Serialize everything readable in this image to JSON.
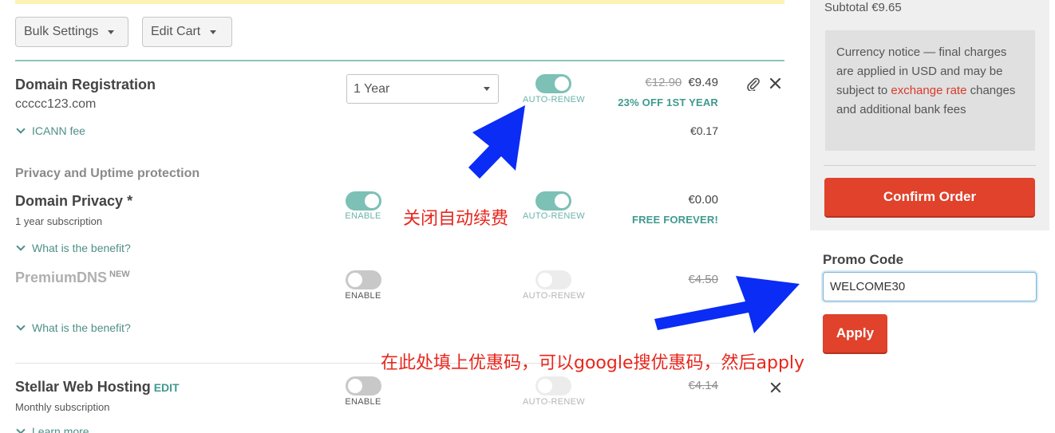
{
  "sidebar": {
    "subtotal": "Subtotal €9.65",
    "notice_before": "Currency notice — final charges are applied in USD and may be subject to ",
    "notice_link": "exchange rate",
    "notice_after": " changes and additional bank fees",
    "confirm_label": "Confirm Order",
    "promo_label": "Promo Code",
    "promo_value": "WELCOME30",
    "apply_label": "Apply"
  },
  "toolbar": {
    "bulk_settings": "Bulk Settings",
    "edit_cart": "Edit Cart"
  },
  "domain_registration": {
    "title": "Domain Registration",
    "domain": "ccccc123.com",
    "period": "1 Year",
    "toggle_label": "AUTO-RENEW",
    "old_price": "€12.90",
    "price": "€9.49",
    "discount": "23% OFF 1ST YEAR",
    "icann_label": "ICANN fee",
    "icann_price": "€0.17",
    "auto_renew_on": true
  },
  "privacy_section": {
    "title": "Privacy and Uptime protection"
  },
  "domain_privacy": {
    "title": "Domain Privacy *",
    "subtitle": "1 year subscription",
    "enable_label": "ENABLE",
    "autorenew_label": "AUTO-RENEW",
    "price": "€0.00",
    "promo": "FREE FOREVER!",
    "benefit": "What is the benefit?"
  },
  "premium_dns": {
    "title": "PremiumDNS",
    "badge": "NEW",
    "enable_label": "ENABLE",
    "autorenew_label": "AUTO-RENEW",
    "price": "€4.50",
    "benefit": "What is the benefit?"
  },
  "web_hosting": {
    "title": "Stellar Web Hosting",
    "edit": "EDIT",
    "subtitle": "Monthly subscription",
    "enable_label": "ENABLE",
    "autorenew_label": "AUTO-RENEW",
    "price": "€4.14",
    "more": "Learn more"
  },
  "annotations": {
    "autorenew_note": "关闭自动续费",
    "promo_note": "在此处填上优惠码，可以google搜优惠码，然后apply"
  },
  "colors": {
    "accent_teal": "#7cc0b6",
    "confirm_red": "#e0422b",
    "annotation_red": "#e8261c",
    "annotation_arrow_blue": "#0a2cf5"
  },
  "icons": {
    "attachment": "paperclip-icon",
    "remove": "close-icon",
    "expand": "chevron-down-icon",
    "dropdown": "caret-down-icon"
  }
}
